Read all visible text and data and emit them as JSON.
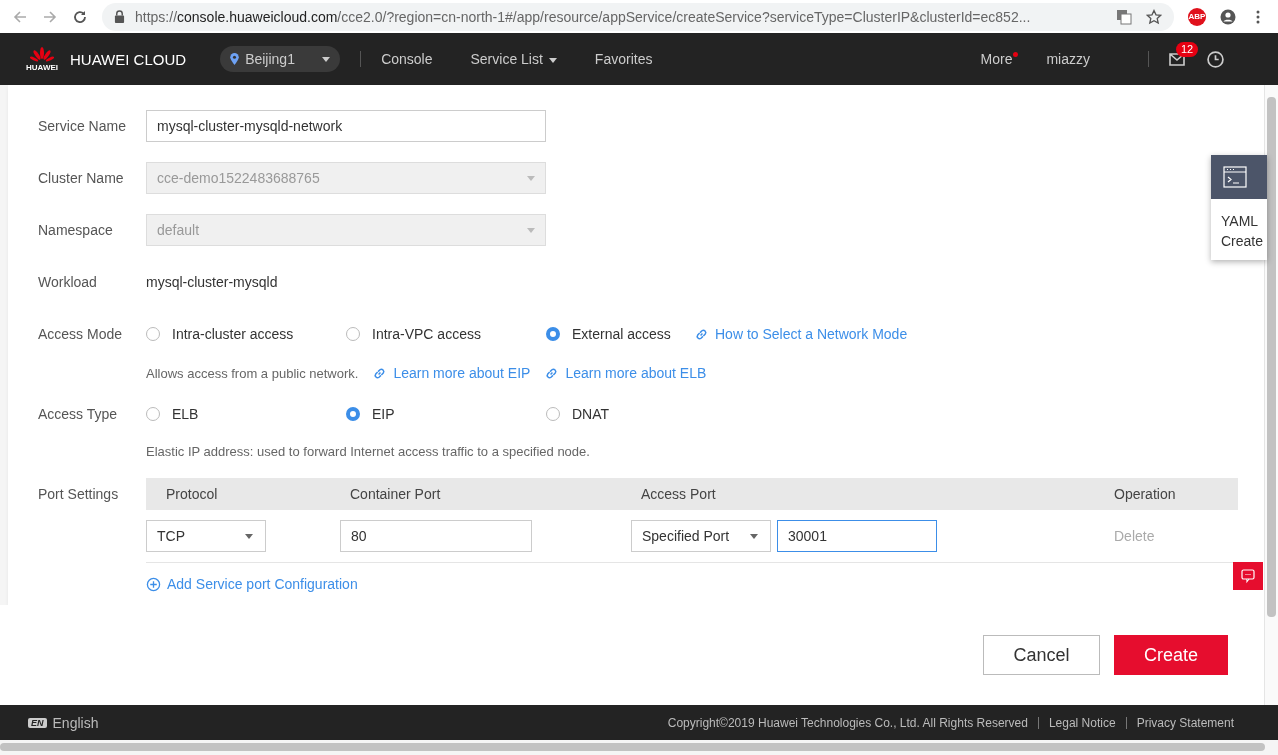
{
  "browser": {
    "url_scheme": "https://",
    "url_host": "console.huaweicloud.com",
    "url_path": "/cce2.0/?region=cn-north-1#/app/resource/appService/createService?serviceType=ClusterIP&clusterId=ec852...",
    "extension": "ABP"
  },
  "header": {
    "logo_text": "HUAWEI",
    "brand": "HUAWEI CLOUD",
    "region": "Beijing1",
    "nav": [
      {
        "label": "Console",
        "dropdown": false
      },
      {
        "label": "Service List",
        "dropdown": true
      },
      {
        "label": "Favorites",
        "dropdown": false
      }
    ],
    "more": "More",
    "user": "miazzy",
    "message_count": "12"
  },
  "form": {
    "service_name": {
      "label": "Service Name",
      "value": "mysql-cluster-mysqld-network",
      "disabled": false
    },
    "cluster_name": {
      "label": "Cluster Name",
      "value": "cce-demo1522483688765",
      "disabled": true
    },
    "namespace": {
      "label": "Namespace",
      "value": "default",
      "disabled": true
    },
    "workload": {
      "label": "Workload",
      "value": "mysql-cluster-mysqld"
    },
    "access_mode": {
      "label": "Access Mode",
      "options": [
        {
          "label": "Intra-cluster access",
          "selected": false
        },
        {
          "label": "Intra-VPC access",
          "selected": false
        },
        {
          "label": "External access",
          "selected": true
        }
      ],
      "help_link": "How to Select a Network Mode",
      "hint": "Allows access from a public network.",
      "links": [
        "Learn more about EIP",
        "Learn more about ELB"
      ]
    },
    "access_type": {
      "label": "Access Type",
      "options": [
        {
          "label": "ELB",
          "selected": false
        },
        {
          "label": "EIP",
          "selected": true
        },
        {
          "label": "DNAT",
          "selected": false
        }
      ],
      "hint": "Elastic IP address: used to forward Internet access traffic to a specified node."
    },
    "port_settings": {
      "label": "Port Settings",
      "columns": [
        "Protocol",
        "Container Port",
        "Access Port",
        "Operation"
      ],
      "rows": [
        {
          "protocol": "TCP",
          "container_port": "80",
          "access_port_mode": "Specified Port",
          "access_port": "30001",
          "operation": "Delete"
        }
      ],
      "add_link": "Add Service port Configuration"
    }
  },
  "yaml_panel": {
    "lines": [
      "YAML",
      "Create"
    ]
  },
  "buttons": [
    {
      "label": "Cancel",
      "kind": "secondary"
    },
    {
      "label": "Create",
      "kind": "primary"
    }
  ],
  "footer": {
    "language_badge": "EN",
    "language": "English",
    "copyright": "Copyright©2019 Huawei Technologies Co., Ltd. All Rights Reserved",
    "links": [
      "Legal Notice",
      "Privacy Statement"
    ]
  }
}
